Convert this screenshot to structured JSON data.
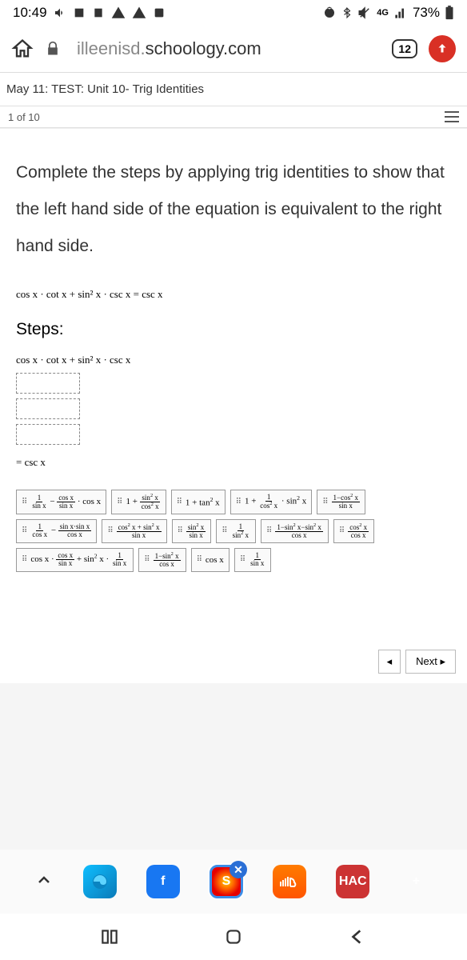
{
  "status": {
    "time": "10:49",
    "battery": "73%",
    "net_label": "4G"
  },
  "browser": {
    "url_gray": "illeenisd.",
    "url_main": "schoology.com",
    "tab_count": "12"
  },
  "assignment": {
    "title": "May 11: TEST: Unit 10- Trig Identities",
    "progress": "1 of 10"
  },
  "question": {
    "prompt": "Complete the steps by applying trig identities to show that the left hand side of the equation is equivalent to the right hand side.",
    "given": "cos x · cot x + sin² x · csc x = csc x",
    "steps_label": "Steps:",
    "step1": "cos x · cot x + sin² x · csc x",
    "result": "= csc x"
  },
  "tiles": [
    "1/sin x − cos x/sin x · cos x",
    "1 + sin² x / cos² x",
    "1 + tan² x",
    "1 + 1/cos² x · sin² x",
    "1−cos² x / sin x",
    "1/cos x − sin x·sin x/cos x",
    "cos² x + sin² x / sin x",
    "sin² x / sin x",
    "1 / sin² x",
    "1−sin² x−sin² x / cos x",
    "cos² x / cos x",
    "cos x · cos x/sin x + sin² x · 1/sin x",
    "1−sin² x / cos x",
    "cos x",
    "1 / sin x"
  ],
  "nav": {
    "back": "◂",
    "next": "Next ▸"
  },
  "apps": {
    "facebook": "f",
    "s_app": "S",
    "hac": "HAC",
    "plus": "+"
  }
}
